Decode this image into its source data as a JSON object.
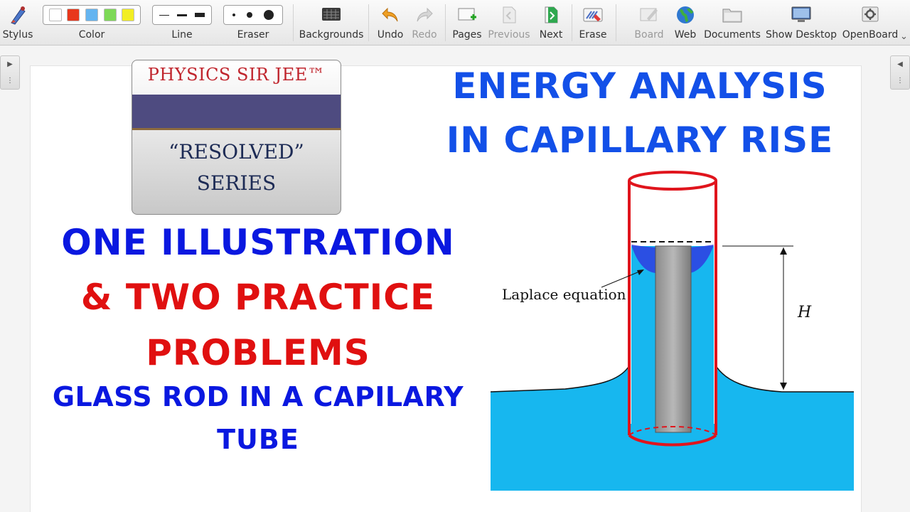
{
  "toolbar": {
    "stylus": "Stylus",
    "color": "Color",
    "line": "Line",
    "eraser": "Eraser",
    "backgrounds": "Backgrounds",
    "undo": "Undo",
    "redo": "Redo",
    "pages": "Pages",
    "previous": "Previous",
    "next": "Next",
    "erase": "Erase",
    "board": "Board",
    "web": "Web",
    "documents": "Documents",
    "show_desktop": "Show Desktop",
    "openboard": "OpenBoard",
    "palette_colors": [
      "#ffffff",
      "#e8381c",
      "#64b4f0",
      "#7ed957",
      "#f2ee24"
    ]
  },
  "logo": {
    "brand": "PHYSICS SIR JEE™",
    "line1": "“RESOLVED”",
    "line2": "SERIES"
  },
  "title": {
    "line1": "ENERGY ANALYSIS",
    "line2": "IN CAPILLARY RISE",
    "color": "#1350e8"
  },
  "subtitle": {
    "line1": "ONE ILLUSTRATION",
    "line2": "& TWO PRACTICE",
    "line3": "PROBLEMS",
    "line4": "GLASS ROD IN A CAPILARY",
    "line5": "TUBE",
    "blue": "#0a18e0",
    "red": "#e01010"
  },
  "diagram": {
    "annotation": "Laplace equation",
    "height_label": "H",
    "water_color": "#17b7ef",
    "tube_color": "#e0141c"
  }
}
